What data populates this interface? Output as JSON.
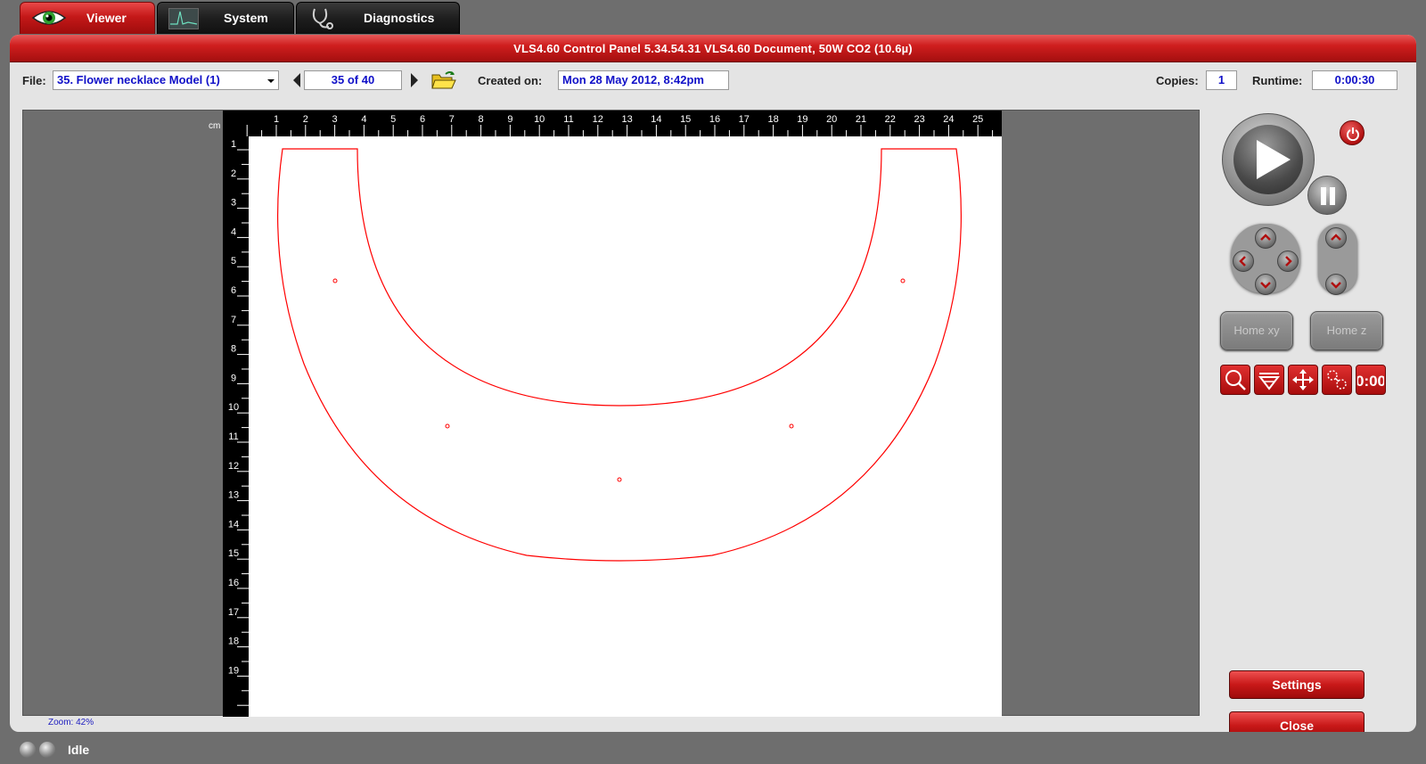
{
  "tabs": [
    {
      "label": "Viewer",
      "icon": "eye-icon"
    },
    {
      "label": "System",
      "icon": "waveform-icon"
    },
    {
      "label": "Diagnostics",
      "icon": "stethoscope-icon"
    }
  ],
  "titlebar": {
    "text": "VLS4.60  Control Panel   5.34.54.31     VLS4.60 Document, 50W CO2 (10.6µ)"
  },
  "toolbar": {
    "file_label": "File:",
    "file_value": "35. Flower necklace Model (1)",
    "page_count": "35 of 40",
    "created_label": "Created on:",
    "created_value": "Mon 28 May 2012,  8:42pm",
    "copies_label": "Copies:",
    "copies_value": "1",
    "runtime_label": "Runtime:",
    "runtime_value": "0:00:30"
  },
  "ruler": {
    "unit": "cm",
    "top_labels": [
      "1",
      "2",
      "3",
      "4",
      "5",
      "6",
      "7",
      "8",
      "9",
      "10",
      "11",
      "12",
      "13",
      "14",
      "15",
      "16",
      "17",
      "18",
      "19",
      "20",
      "21",
      "22",
      "23",
      "24",
      "25"
    ],
    "left_labels": [
      "1",
      "2",
      "3",
      "4",
      "5",
      "6",
      "7",
      "8",
      "9",
      "10",
      "11",
      "12",
      "13",
      "14",
      "15",
      "16",
      "17",
      "18",
      "19"
    ]
  },
  "zoom": "Zoom: 42%",
  "controls": {
    "home_xy": "Home xy",
    "home_z": "Home z",
    "settings": "Settings",
    "close": "Close"
  },
  "colors": {
    "accent": "#c81818",
    "cut_line": "#ff0000",
    "value_text": "#1010c8"
  },
  "status": {
    "text": "Idle"
  }
}
